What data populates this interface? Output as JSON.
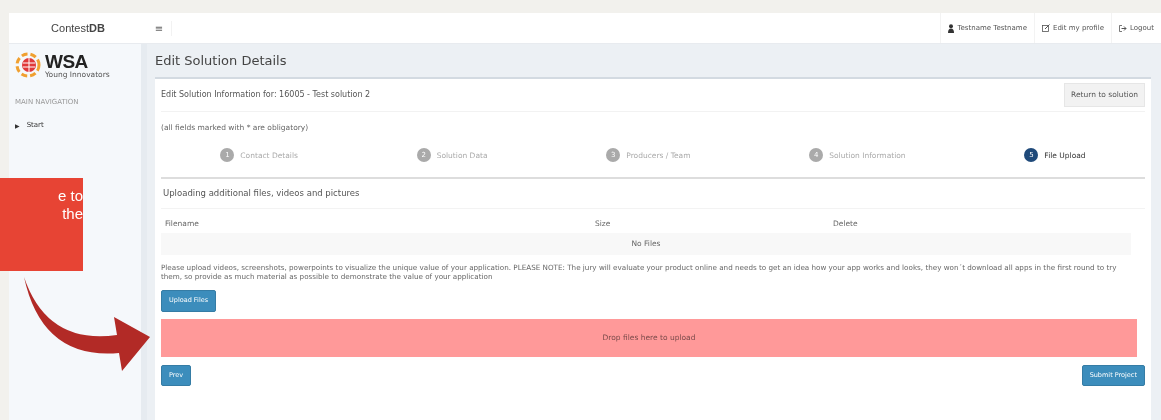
{
  "brand": "Contest**DB**",
  "menu_toggle": "≡",
  "user_menu": [
    {
      "kind": "user",
      "label": "Testname Testname"
    },
    {
      "kind": "edit",
      "label": "Edit my profile"
    },
    {
      "kind": "logout",
      "label": "Logout"
    }
  ],
  "logo": {
    "title": "WSA",
    "subtitle": "Young Innovators"
  },
  "sidebar": {
    "heading": "MAIN NAVIGATION",
    "items": [
      {
        "label": "Start",
        "icon": "▶"
      }
    ]
  },
  "page_title": "Edit Solution Details",
  "card": {
    "title": "Edit Solution Information for: 16005 - Test solution 2",
    "return_button": "Return to solution",
    "notice": "(all fields marked with * are obligatory)",
    "steps": [
      {
        "number": "1",
        "label": "Contact Details",
        "selected": false
      },
      {
        "number": "2",
        "label": "Solution Data",
        "selected": false
      },
      {
        "number": "3",
        "label": "Producers / Team",
        "selected": false
      },
      {
        "number": "4",
        "label": "Solution Information",
        "selected": false
      },
      {
        "number": "5",
        "label": "File Upload",
        "selected": true
      }
    ],
    "section_title": "Uploading additional files, videos and pictures",
    "table": {
      "columns": [
        "Filename",
        "Size",
        "Delete"
      ],
      "empty_message": "No Files"
    },
    "help_text": "Please upload videos, screenshots, powerpoints to visualize the unique value of your application. PLEASE NOTE: The jury will evaluate your product online and needs to get an idea how your app works and looks, they won´t download all apps in the first round to try them, so provide as much material as possible to demonstrate the value of your application",
    "upload_button": "Upload Files",
    "dropzone": "Drop files here to upload",
    "prev_button": "Prev",
    "submit_button": "Submit Project"
  },
  "callout": {
    "lines": [
      "e to",
      "the"
    ]
  }
}
